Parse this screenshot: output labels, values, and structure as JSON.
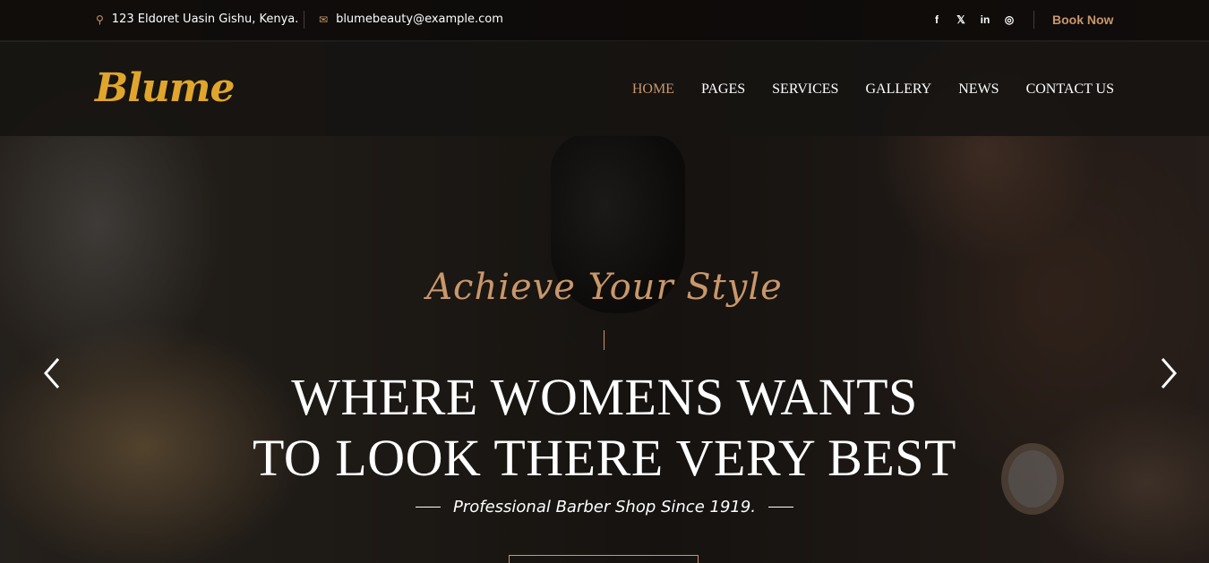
{
  "topbar": {
    "address": "123 Eldoret Uasin Gishu, Kenya.",
    "email": "blumebeauty@example.com",
    "social": [
      {
        "name": "facebook-icon",
        "glyph": "f"
      },
      {
        "name": "x-icon",
        "glyph": "𝕏"
      },
      {
        "name": "linkedin-icon",
        "glyph": "in"
      },
      {
        "name": "instagram-icon",
        "glyph": "◎"
      }
    ],
    "book_now": "Book Now"
  },
  "navbar": {
    "logo": "Blume",
    "items": [
      {
        "label": "HOME",
        "active": true
      },
      {
        "label": "PAGES",
        "active": false
      },
      {
        "label": "SERVICES",
        "active": false
      },
      {
        "label": "GALLERY",
        "active": false
      },
      {
        "label": "NEWS",
        "active": false
      },
      {
        "label": "CONTACT US",
        "active": false
      }
    ]
  },
  "hero": {
    "script_title": "Achieve Your Style",
    "headline_line1": "WHERE WOMENS WANTS",
    "headline_line2": "TO LOOK THERE VERY BEST",
    "subtitle": "Professional Barber Shop Since 1919."
  },
  "colors": {
    "accent": "#c9976a",
    "logo": "#e0a52c"
  }
}
